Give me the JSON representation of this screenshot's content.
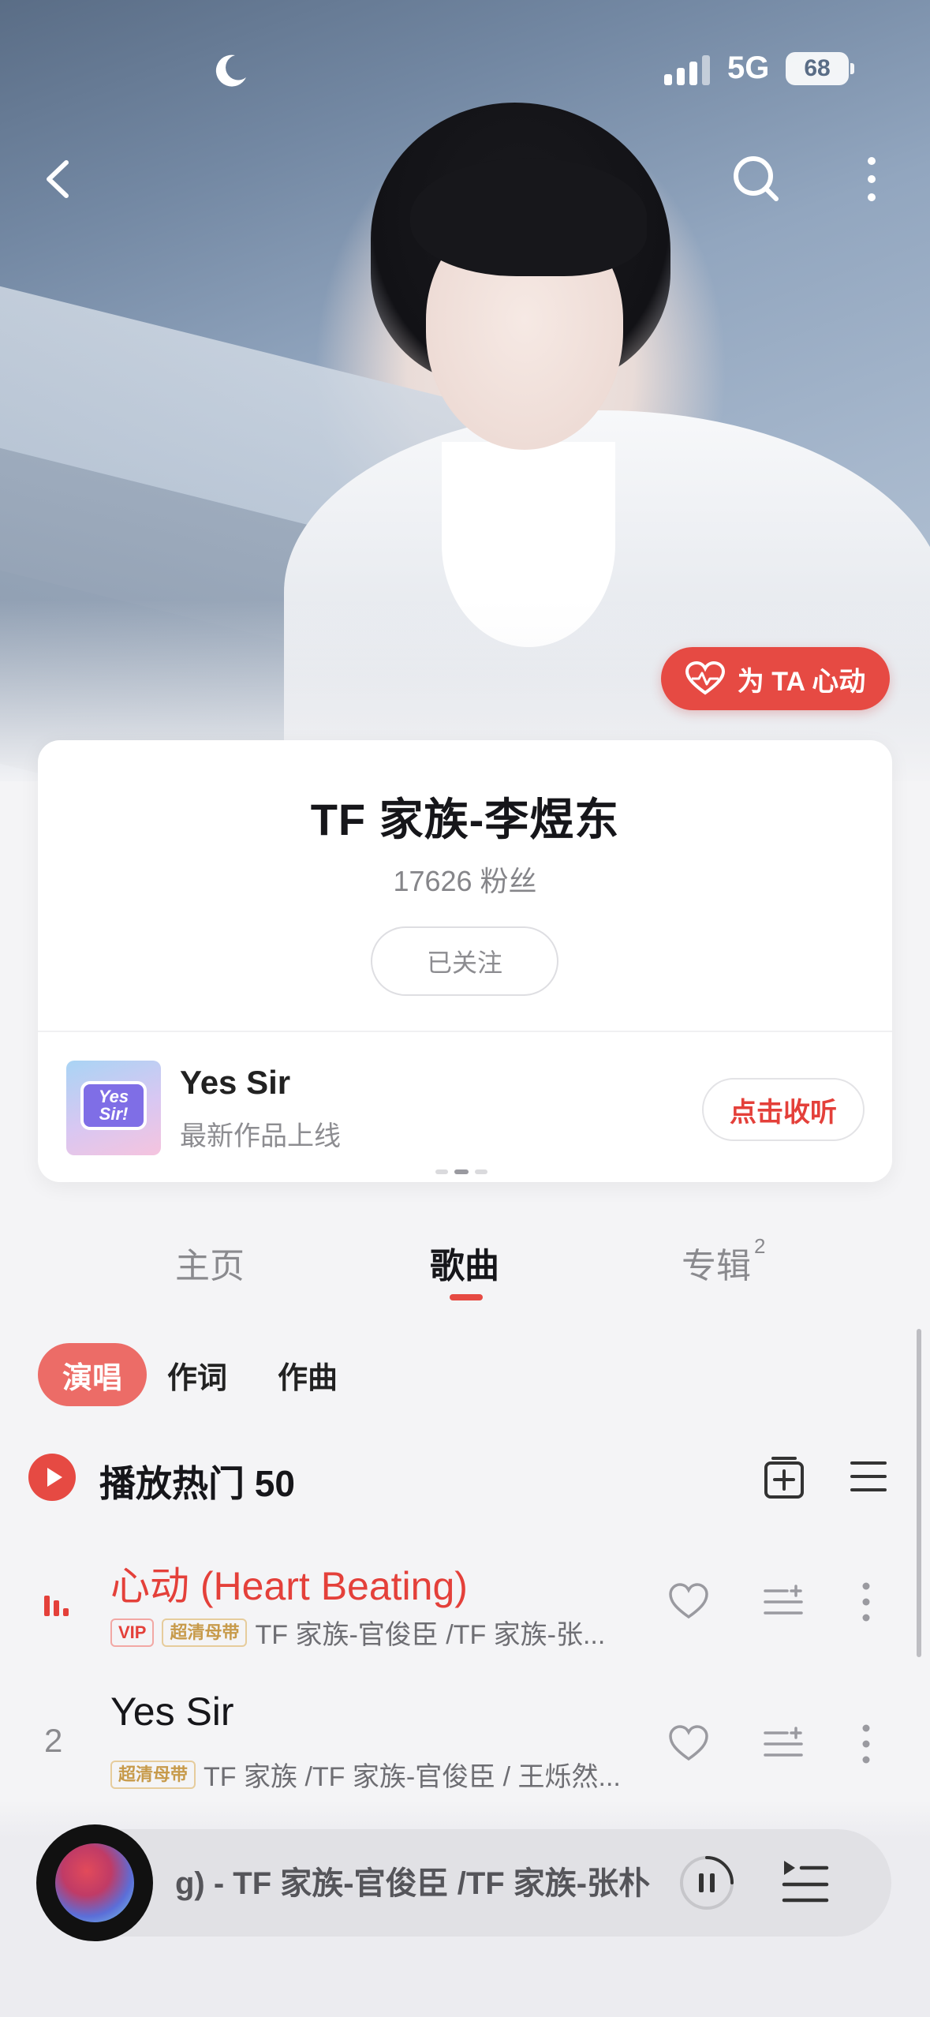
{
  "status_bar": {
    "network": "5G",
    "battery": "68"
  },
  "artist": {
    "heart_button_label": "为 TA 心动",
    "name": "TF 家族-李煜东",
    "fans": "17626 粉丝",
    "follow_state": "已关注"
  },
  "featured": {
    "album_art_text": "Yes Sir!",
    "title": "Yes Sir",
    "subtitle": "最新作品上线",
    "listen_label": "点击收听"
  },
  "tabs": [
    {
      "label": "主页",
      "count": ""
    },
    {
      "label": "歌曲",
      "count": ""
    },
    {
      "label": "专辑",
      "count": "2"
    }
  ],
  "filters": [
    "演唱",
    "作词",
    "作曲"
  ],
  "play_all": {
    "label": "播放热门 50"
  },
  "songs": [
    {
      "rank": "",
      "title": "心动 (Heart Beating)",
      "badges": [
        "VIP",
        "超清母带"
      ],
      "artists": "TF 家族-官俊臣 /TF 家族-张...",
      "playing": true
    },
    {
      "rank": "2",
      "title": "Yes Sir",
      "badges": [
        "超清母带"
      ],
      "artists": "TF 家族 /TF 家族-官俊臣 / 王烁然...",
      "playing": false
    }
  ],
  "mini_player": {
    "track_text": "g) - TF 家族-官俊臣 /TF 家族-张朴"
  },
  "colors": {
    "accent": "#e64a43",
    "chip": "#ec6c67"
  }
}
